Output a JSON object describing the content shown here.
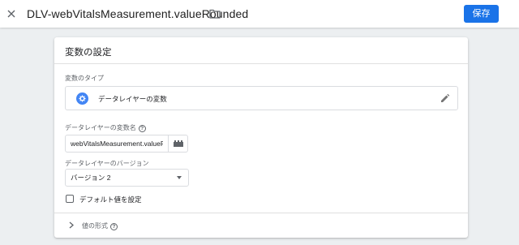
{
  "header": {
    "variable_name": "DLV-webVitalsMeasurement.valueRounded",
    "save_label": "保存"
  },
  "card": {
    "title": "変数の設定",
    "type_section_label": "変数のタイプ",
    "type_name": "データレイヤーの変数",
    "dlv_name_label": "データレイヤーの変数名",
    "dlv_name_value": "webVitalsMeasurement.valueRounded",
    "version_label": "データレイヤーのバージョン",
    "version_value": "バージョン 2",
    "default_checkbox_label": "デフォルト値を設定",
    "format_label": "値の形式"
  },
  "colors": {
    "accent": "#1a73e8",
    "type_icon": "#4285f4"
  },
  "icons": {
    "close": "close-icon",
    "folder": "folder-icon",
    "type": "gear-icon",
    "edit": "pencil-icon",
    "picker": "variable-picker-icon",
    "help": "help-icon",
    "dropdown": "dropdown-arrow-icon",
    "expand": "chevron-right-icon"
  }
}
